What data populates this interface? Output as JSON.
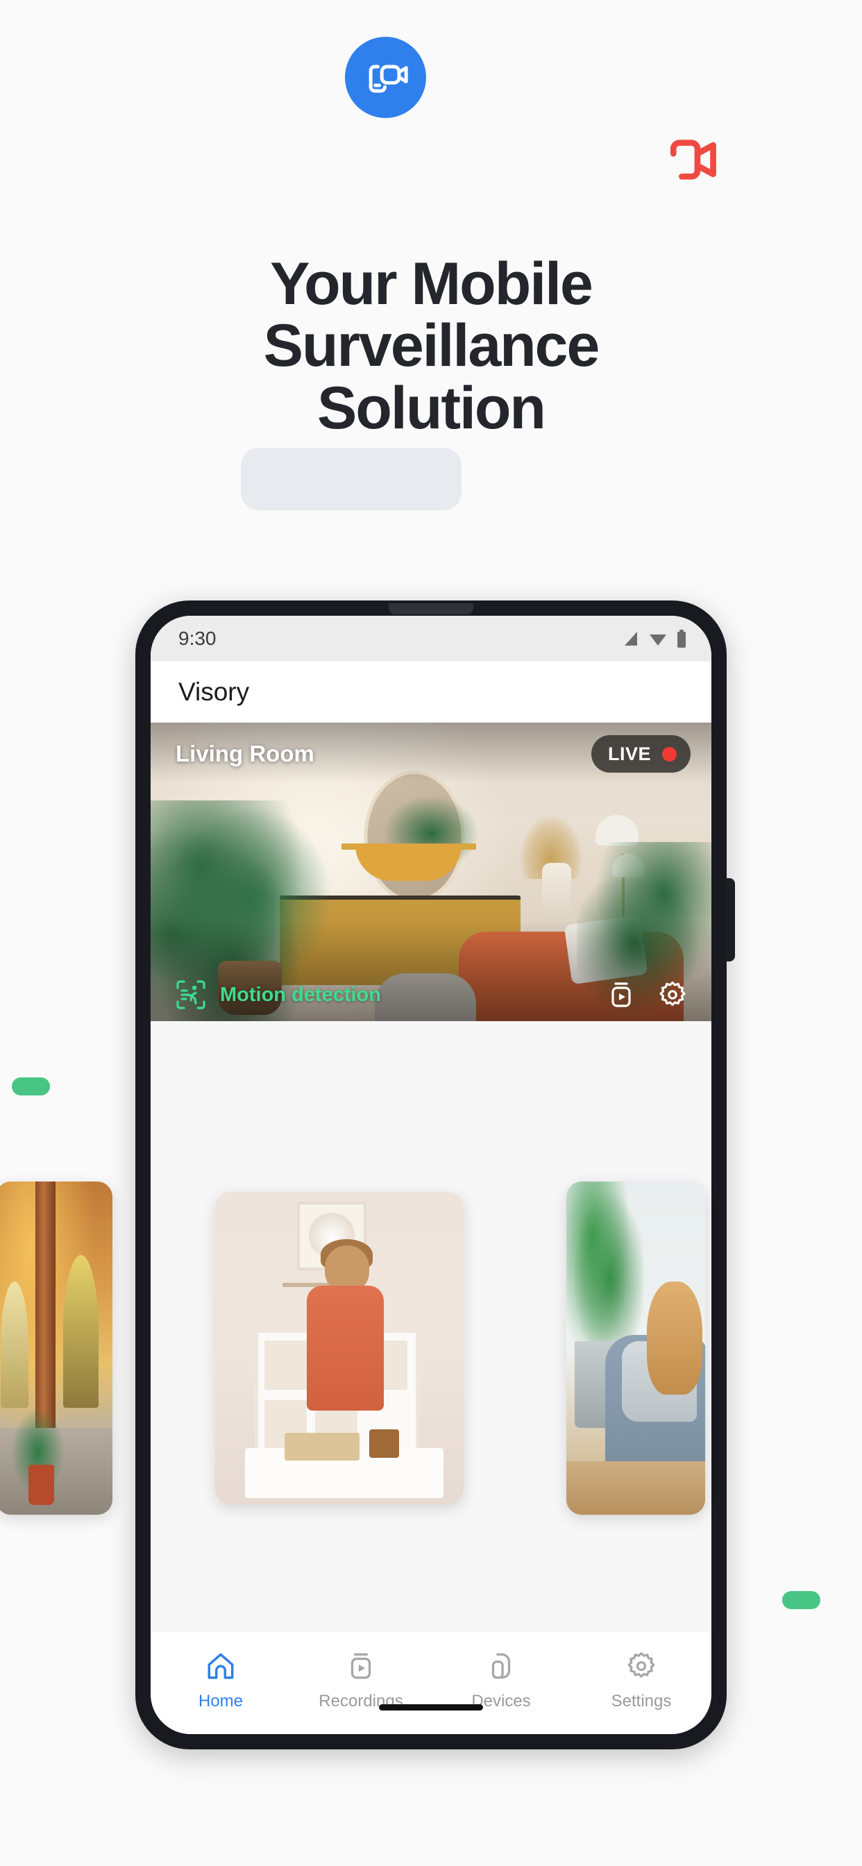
{
  "hero": {
    "logo_icon": "video-camera-icon",
    "logo_bg": "#2f80ed",
    "accent_icon": "video-camera-accent-icon",
    "accent_color": "#ef4a41",
    "headline_line1": "Your Mobile",
    "headline_line2": "Surveillance",
    "headline_line3": "Solution",
    "highlight_color": "#e8eaef",
    "text_color": "#24262b"
  },
  "decor": {
    "pill_color": "#48c585",
    "pill_left_name": "decor-pill-left",
    "pill_right_name": "decor-pill-right"
  },
  "phone": {
    "status_bar": {
      "time": "9:30",
      "icons": [
        "signal-icon",
        "wifi-icon",
        "battery-icon"
      ]
    },
    "app_bar": {
      "title": "Visory"
    },
    "live_view": {
      "camera_name": "Living Room",
      "live_label": "LIVE",
      "live_dot_color": "#f03a34",
      "motion_label": "Motion detection",
      "motion_color": "#3ddc8f",
      "motion_icon": "motion-detection-icon",
      "actions": [
        "recordings-icon",
        "gear-icon"
      ]
    },
    "carousel": {
      "cards": [
        {
          "name": "carousel-card-courtyard",
          "alt": "courtyard with plants"
        },
        {
          "name": "carousel-card-playroom",
          "alt": "child playing with toys"
        },
        {
          "name": "carousel-card-petbed",
          "alt": "dog resting in bean bag"
        }
      ]
    },
    "bottom_nav": {
      "active_color": "#2f80ed",
      "inactive_color": "#9a9a9e",
      "items": [
        {
          "label": "Home",
          "icon": "home-icon",
          "active": true
        },
        {
          "label": "Recordings",
          "icon": "recordings-icon",
          "active": false
        },
        {
          "label": "Devices",
          "icon": "devices-icon",
          "active": false
        },
        {
          "label": "Settings",
          "icon": "settings-gear-icon",
          "active": false
        }
      ]
    }
  }
}
